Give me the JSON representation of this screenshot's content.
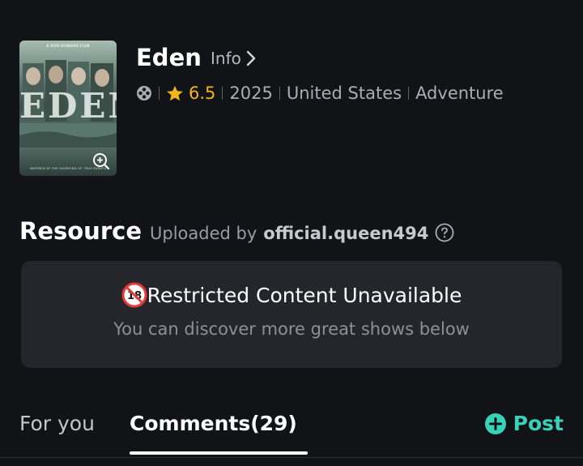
{
  "movie": {
    "title": "Eden",
    "info_link": "Info",
    "rating": "6.5",
    "year": "2025",
    "country": "United States",
    "genre": "Adventure",
    "poster": {
      "credit": "A RON HOWARD FILM",
      "title_text": "EDEN",
      "tagline": "INSPIRED BY THE HAUNTING OF TRUE EVENTS"
    }
  },
  "resource": {
    "title": "Resource",
    "uploaded_by_label": "Uploaded by",
    "uploader": "official.queen494"
  },
  "restricted": {
    "title": "Restricted Content Unavailable",
    "subtitle": "You can discover more great shows below"
  },
  "tabs": {
    "for_you": "For you",
    "comments": "Comments(29)",
    "post": "Post"
  },
  "colors": {
    "background": "#121317",
    "card": "#25262b",
    "rating": "#f2b51d",
    "post_accent": "#38d2b8"
  },
  "icons": {
    "info_chevron": "chevron-right-icon",
    "film_reel": "film-reel-icon",
    "rating_star": "star-icon",
    "zoom": "zoom-in-icon",
    "help": "question-circle-icon",
    "restricted": "no-18-icon",
    "post": "plus-circle-icon"
  }
}
